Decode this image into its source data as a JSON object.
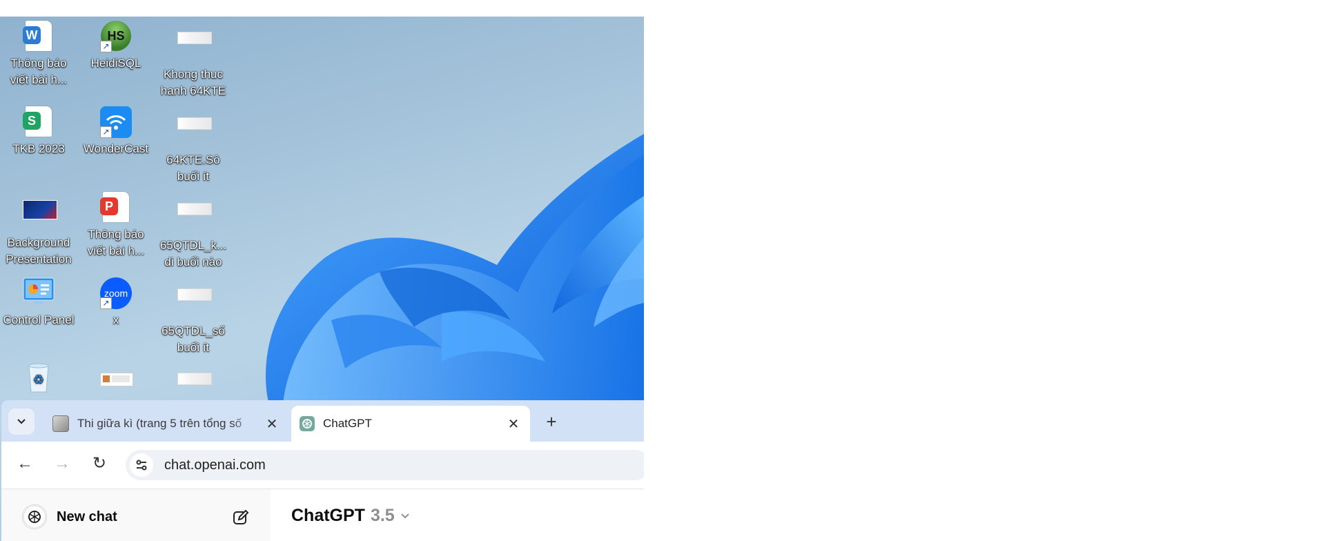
{
  "desktop": {
    "icons": [
      {
        "label": "Thông báo viết bài h...",
        "icon": "word-document-icon",
        "color": "#2b7cd3"
      },
      {
        "label": "HeidiSQL",
        "icon": "heidisql-icon",
        "color": "#3a7d2a"
      },
      {
        "label": "Khong thuc hanh 64KTE",
        "icon": "spreadsheet-thumbnail-icon"
      },
      {
        "label": "TKB 2023",
        "icon": "sheet-document-icon",
        "color": "#1fa463"
      },
      {
        "label": "WonderCast",
        "icon": "wondercast-icon",
        "color": "#1c8cf2"
      },
      {
        "label": "64KTE.Sô buổi ít",
        "icon": "spreadsheet-thumbnail-icon"
      },
      {
        "label": "Background Presentation",
        "icon": "presentation-thumbnail-icon"
      },
      {
        "label": "Thông báo viết bài h...",
        "icon": "pdf-document-icon",
        "color": "#e5392f"
      },
      {
        "label": "65QTDL_k... di buổi nào",
        "icon": "spreadsheet-thumbnail-icon"
      },
      {
        "label": "Control Panel",
        "icon": "control-panel-icon"
      },
      {
        "label": "x",
        "icon": "zoom-icon",
        "color": "#0b5cff"
      },
      {
        "label": "65QTDL_số buổi ít",
        "icon": "spreadsheet-thumbnail-icon"
      },
      {
        "label": "",
        "icon": "recycle-bin-icon"
      },
      {
        "label": "",
        "icon": "image-thumbnail-icon"
      },
      {
        "label": "",
        "icon": "spreadsheet-thumbnail-icon"
      }
    ],
    "heidisql_badge": "HS",
    "zoom_badge": "zoom",
    "word_badge": "W",
    "sheet_badge": "S",
    "pdf_badge": "P"
  },
  "browser": {
    "tab_search_icon": "chevron-down-icon",
    "tabs": [
      {
        "title": "Thi giữa kì (trang 5 trên tổng số",
        "active": false,
        "close": "✕"
      },
      {
        "title": "ChatGPT",
        "active": true,
        "close": "✕"
      }
    ],
    "new_tab_label": "+",
    "back_glyph": "←",
    "forward_glyph": "→",
    "reload_glyph": "↻",
    "url": "chat.openai.com"
  },
  "chatgpt": {
    "new_chat_label": "New chat",
    "model_name": "ChatGPT",
    "model_version": "3.5"
  },
  "colors": {
    "accent_blue": "#1e6ff0",
    "tab_strip": "#d3e1f6",
    "sidebar": "#f9f9f9"
  }
}
